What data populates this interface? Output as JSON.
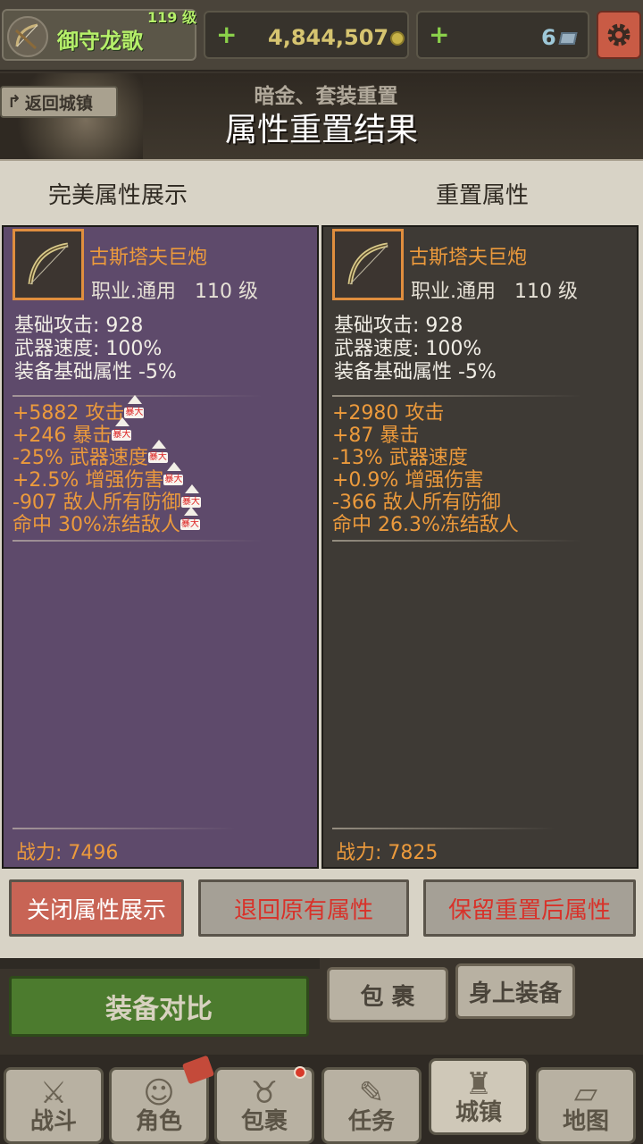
{
  "player": {
    "name": "御守龙歌",
    "level": "119 级",
    "icon": "crossbow-icon"
  },
  "resources": {
    "gold": "4,844,507",
    "gems": "6",
    "plus": "+",
    "gold_icon": "coin-icon",
    "gem_icon": "gem-icon"
  },
  "header": {
    "back_label": "返回城镇",
    "subtitle": "暗金、套装重置",
    "title": "属性重置结果"
  },
  "columns": {
    "left_title": "完美属性展示",
    "right_title": "重置属性"
  },
  "item": {
    "name": "古斯塔夫巨炮",
    "job": "职业.通用",
    "level": "110 级",
    "icon": "bow-icon"
  },
  "base_stats": [
    "基础攻击:  928",
    "武器速度:  100%",
    "装备基础属性 -5%"
  ],
  "left_panel": {
    "stats": [
      "+5882 攻击",
      "+246 暴击",
      "-25% 武器速度",
      "+2.5% 增强伤害",
      "-907 敌人所有防御",
      "命中 30%冻结敌人"
    ],
    "crit_badge": "暴大",
    "power": "战力:  7496"
  },
  "right_panel": {
    "stats": [
      "+2980 攻击",
      "+87 暴击",
      "-13% 武器速度",
      "+0.9% 增强伤害",
      "-366 敌人所有防御",
      "命中 26.3%冻结敌人"
    ],
    "power": "战力:  7825"
  },
  "buttons": {
    "close_display": "关闭属性展示",
    "revert": "退回原有属性",
    "keep": "保留重置后属性",
    "compare": "装备对比",
    "bag": "包 裹",
    "equipped": "身上装备"
  },
  "nav": [
    {
      "label": "战斗",
      "icon": "sword-icon"
    },
    {
      "label": "角色",
      "icon": "character-icon"
    },
    {
      "label": "包裹",
      "icon": "bag-icon"
    },
    {
      "label": "任务",
      "icon": "quest-icon"
    },
    {
      "label": "城镇",
      "icon": "castle-icon"
    },
    {
      "label": "地图",
      "icon": "map-icon"
    }
  ],
  "colors": {
    "left_panel": "#5e4a6b",
    "right_panel": "#3e3a35",
    "stat_orange": "#ec9a3c",
    "name_green": "#b6f06a",
    "danger_red": "#d8322a"
  }
}
